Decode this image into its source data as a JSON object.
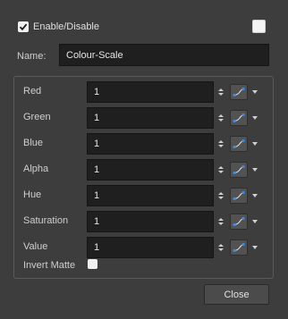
{
  "header": {
    "enable_label": "Enable/Disable",
    "enable_checked": true
  },
  "name": {
    "label": "Name:",
    "value": "Colour-Scale"
  },
  "fields": [
    {
      "label": "Red",
      "value": "1"
    },
    {
      "label": "Green",
      "value": "1"
    },
    {
      "label": "Blue",
      "value": "1"
    },
    {
      "label": "Alpha",
      "value": "1"
    },
    {
      "label": "Hue",
      "value": "1"
    },
    {
      "label": "Saturation",
      "value": "1"
    },
    {
      "label": "Value",
      "value": "1"
    }
  ],
  "invert_matte": {
    "label": "Invert Matte",
    "checked": false
  },
  "footer": {
    "close_label": "Close"
  },
  "icons": {
    "checkmark": "checkmark-icon",
    "spinner": "spinner-arrows-icon",
    "curve": "function-curve-icon",
    "dropdown": "chevron-down-icon"
  }
}
